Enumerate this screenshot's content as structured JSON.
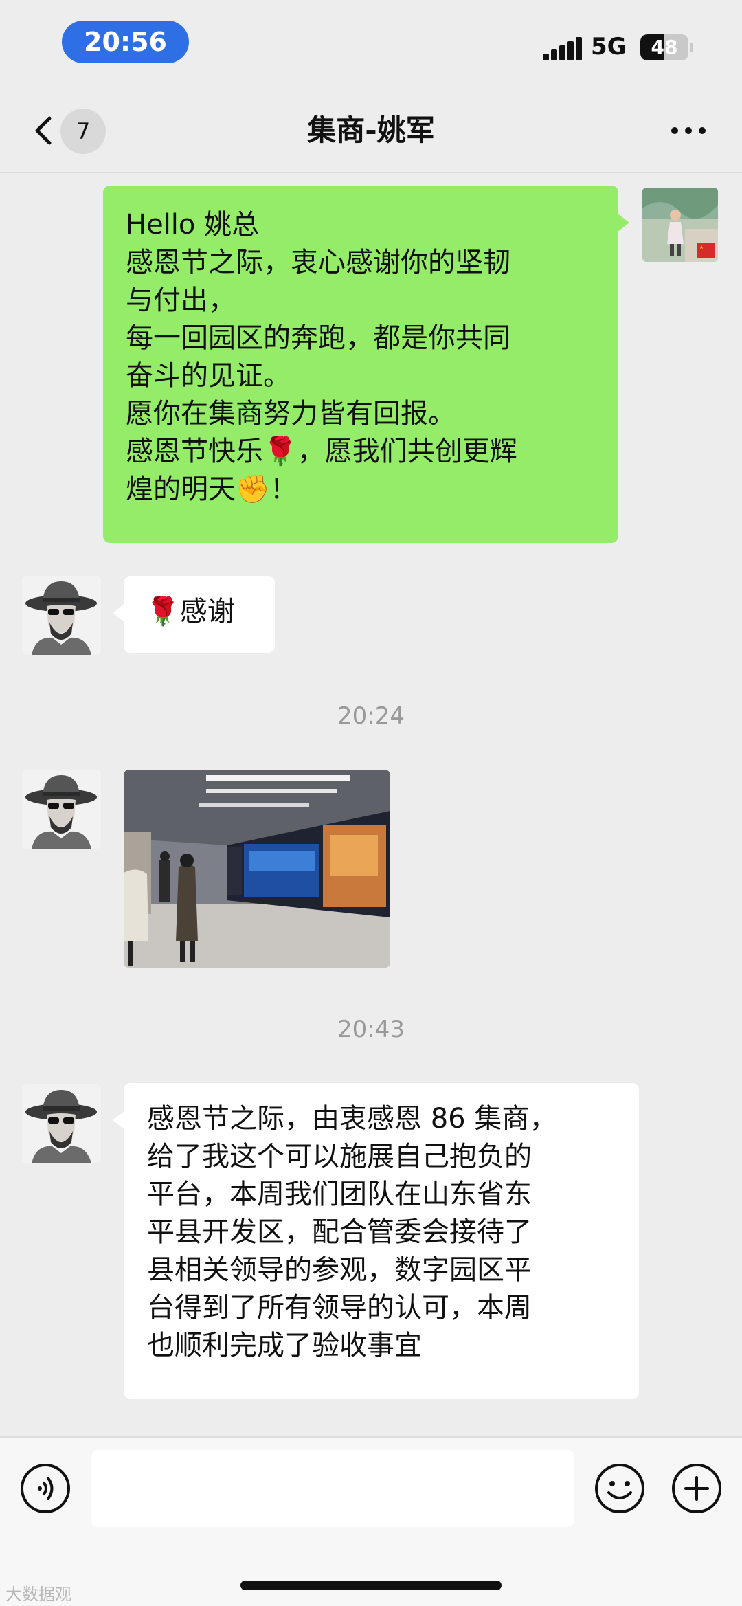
{
  "status_bar": {
    "time": "20:56",
    "network": "5G",
    "battery": "48",
    "battery_level": 0.48
  },
  "nav": {
    "unread_count": "7",
    "title": "集商-姚军"
  },
  "messages": {
    "outgoing_1": "Hello 姚总\n感恩节之际，衷心感谢你的坚韧\n与付出，\n每一回园区的奔跑，都是你共同\n奋斗的见证。\n愿你在集商努力皆有回报。\n感恩节快乐🌹，愿我们共创更辉\n煌的明天✊！",
    "incoming_1": "🌹感谢",
    "timestamp_1": "20:24",
    "timestamp_2": "20:43",
    "incoming_3": "感恩节之际，由衷感恩 86 集商，\n给了我这个可以施展自己抱负的\n平台，本周我们团队在山东省东\n平县开发区，配合管委会接待了\n县相关领导的参观，数字园区平\n台得到了所有领导的认可，本周\n也顺利完成了验收事宜"
  },
  "watermark": "大数据观",
  "colors": {
    "outgoing_bubble": "#95ec69",
    "background": "#ededed",
    "time_pill": "#2f6fe6"
  },
  "icons": [
    "chevron-left-icon",
    "more-icon",
    "voice-icon",
    "emoji-icon",
    "plus-icon"
  ]
}
